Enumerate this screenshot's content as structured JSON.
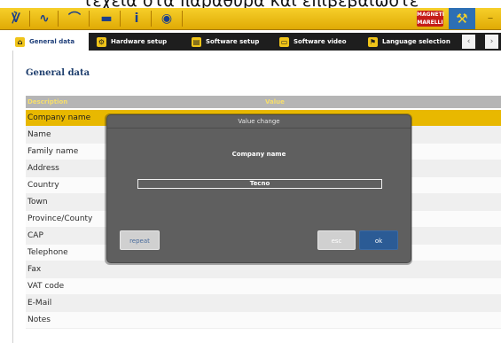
{
  "caption": "τεχεία στα παράθυρα και επιβεβαιώστε",
  "toolbar": {
    "icons": [
      {
        "name": "diagnosis-icon",
        "glyph": "℣"
      },
      {
        "name": "oscilloscope-icon",
        "glyph": "∿"
      },
      {
        "name": "antenna-icon",
        "glyph": "⌒"
      },
      {
        "name": "folder-icon",
        "glyph": "▬"
      },
      {
        "name": "info-icon",
        "glyph": "i"
      },
      {
        "name": "globe-icon",
        "glyph": "◉"
      }
    ],
    "brand_label": "MAGNETI MARELLI",
    "tools_icon": "tools-icon"
  },
  "tabs": [
    {
      "label": "General data",
      "icon": "company-icon",
      "active": true
    },
    {
      "label": "Hardware setup",
      "icon": "gear-icon",
      "active": false
    },
    {
      "label": "Software setup",
      "icon": "document-icon",
      "active": false
    },
    {
      "label": "Software video",
      "icon": "video-icon",
      "active": false
    },
    {
      "label": "Language selection",
      "icon": "flag-icon",
      "active": false
    }
  ],
  "tab_nav": {
    "prev": "‹",
    "next": "›"
  },
  "page": {
    "title": "General data",
    "columns": [
      "Description",
      "Value"
    ],
    "rows": [
      {
        "description": "Company name",
        "value": "",
        "selected": true
      },
      {
        "description": "Name",
        "value": ""
      },
      {
        "description": "Family name",
        "value": ""
      },
      {
        "description": "Address",
        "value": ""
      },
      {
        "description": "Country",
        "value": ""
      },
      {
        "description": "Town",
        "value": ""
      },
      {
        "description": "Province/County",
        "value": ""
      },
      {
        "description": "CAP",
        "value": ""
      },
      {
        "description": "Telephone",
        "value": ""
      },
      {
        "description": "Fax",
        "value": ""
      },
      {
        "description": "VAT code",
        "value": ""
      },
      {
        "description": "E-Mail",
        "value": ""
      },
      {
        "description": "Notes",
        "value": ""
      }
    ]
  },
  "dialog": {
    "title": "Value change",
    "field_label": "Company name",
    "input_value": "Tecno",
    "buttons": {
      "repeat": "repeat",
      "esc": "esc",
      "ok": "ok"
    }
  },
  "colors": {
    "toolbar": "#e8b800",
    "selected_row": "#e8b800",
    "dialog": "#5f5f5f",
    "ok_button": "#2b5b95"
  }
}
